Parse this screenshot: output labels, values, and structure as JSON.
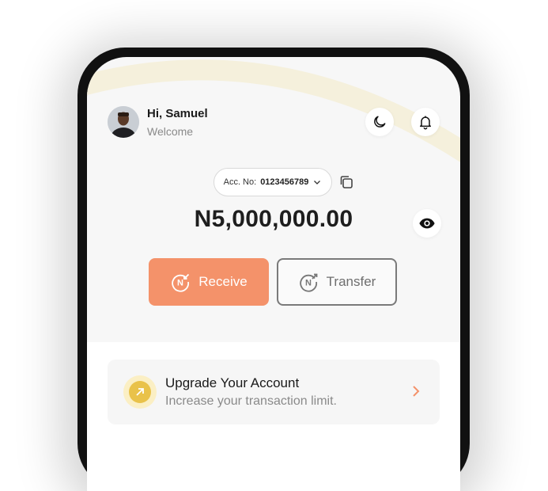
{
  "header": {
    "greeting": "Hi, Samuel",
    "subtitle": "Welcome"
  },
  "account": {
    "label": "Acc. No:",
    "number": "0123456789"
  },
  "balance": {
    "amount": "N5,000,000.00"
  },
  "actions": {
    "receive_label": "Receive",
    "transfer_label": "Transfer"
  },
  "upgrade": {
    "title": "Upgrade Your Account",
    "subtitle": "Increase your transaction limit."
  },
  "colors": {
    "accent": "#f4926a",
    "upgrade_icon": "#e9c24a",
    "arc": "#f5f0dc"
  },
  "icons": {
    "theme": "moon-icon",
    "notifications": "bell-icon",
    "dropdown": "chevron-down-icon",
    "copy": "copy-icon",
    "visibility": "eye-icon",
    "receive": "naira-receive-icon",
    "transfer": "naira-transfer-icon",
    "upgrade": "arrow-up-right-icon",
    "open": "chevron-right-icon"
  }
}
